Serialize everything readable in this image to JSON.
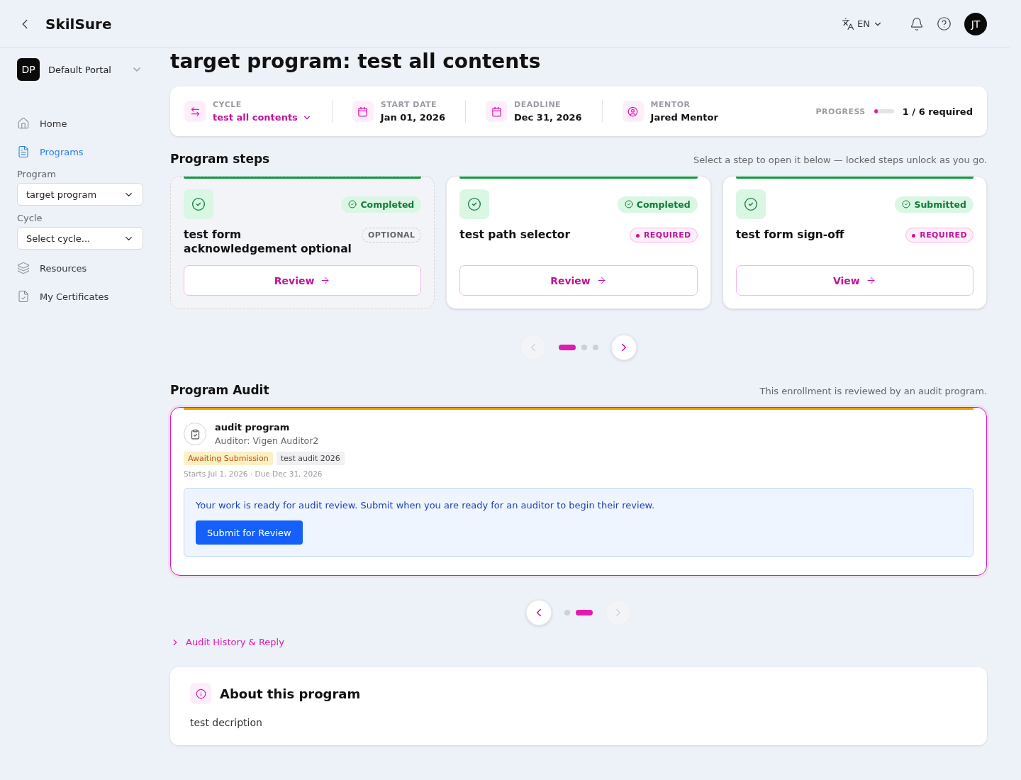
{
  "header": {
    "brand": "SkilSure",
    "language": "EN",
    "avatar": "JT"
  },
  "sidebar": {
    "portal": {
      "initials": "DP",
      "name": "Default Portal"
    },
    "items": [
      {
        "label": "Home",
        "selected": false
      },
      {
        "label": "Programs",
        "selected": true
      }
    ],
    "filters": [
      {
        "label": "Program",
        "value": "target program"
      },
      {
        "label": "Cycle",
        "value": "Select cycle..."
      }
    ],
    "items_after": [
      {
        "label": "Resources",
        "selected": false
      },
      {
        "label": "My Certificates",
        "selected": false
      }
    ]
  },
  "title": "target program: test all contents",
  "info": {
    "cycle": {
      "label": "CYCLE",
      "value": "test all contents"
    },
    "start": {
      "label": "START DATE",
      "value": "Jan 01, 2026"
    },
    "deadline": {
      "label": "DEADLINE",
      "value": "Dec 31, 2026"
    },
    "mentor": {
      "label": "MENTOR",
      "value": "Jared Mentor"
    },
    "progress": {
      "label": "PROGRESS",
      "level": 0.17,
      "reading": "1 / 6 required"
    }
  },
  "steps": {
    "title": "Program steps",
    "hint": "Select a step to open it below — locked steps unlock as you go.",
    "items": [
      {
        "name": "test form acknowledgement optional",
        "status": "Completed",
        "requirement": "OPTIONAL",
        "optional": true,
        "action": "Review"
      },
      {
        "name": "test path selector",
        "status": "Completed",
        "requirement": "REQUIRED",
        "optional": false,
        "action": "Review"
      },
      {
        "name": "test form sign-off",
        "status": "Submitted",
        "requirement": "REQUIRED",
        "optional": false,
        "action": "View"
      }
    ],
    "pager": {
      "prev_disabled": true,
      "next_disabled": false,
      "dots": [
        {
          "selected": true
        },
        {
          "selected": false
        },
        {
          "selected": false
        }
      ]
    }
  },
  "audit": {
    "title": "Program Audit",
    "hint": "This enrollment is reviewed by an audit program.",
    "card": {
      "name": "audit program",
      "auditor": "Auditor: Vigen Auditor2",
      "tags": [
        {
          "label": "Awaiting Submission",
          "kind": "status"
        },
        {
          "label": "test audit 2026",
          "kind": "plain"
        }
      ],
      "dates": "Starts Jul 1, 2026 · Due Dec 31, 2026",
      "notice": "Your work is ready for audit review. Submit when you are ready for an auditor to begin their review.",
      "button": "Submit for Review"
    },
    "pager": {
      "prev_disabled": false,
      "next_disabled": true,
      "dots": [
        {
          "selected": false
        },
        {
          "selected": true
        }
      ]
    },
    "history": "Audit History & Reply"
  },
  "about": {
    "title": "About this program",
    "text": "test decription"
  }
}
